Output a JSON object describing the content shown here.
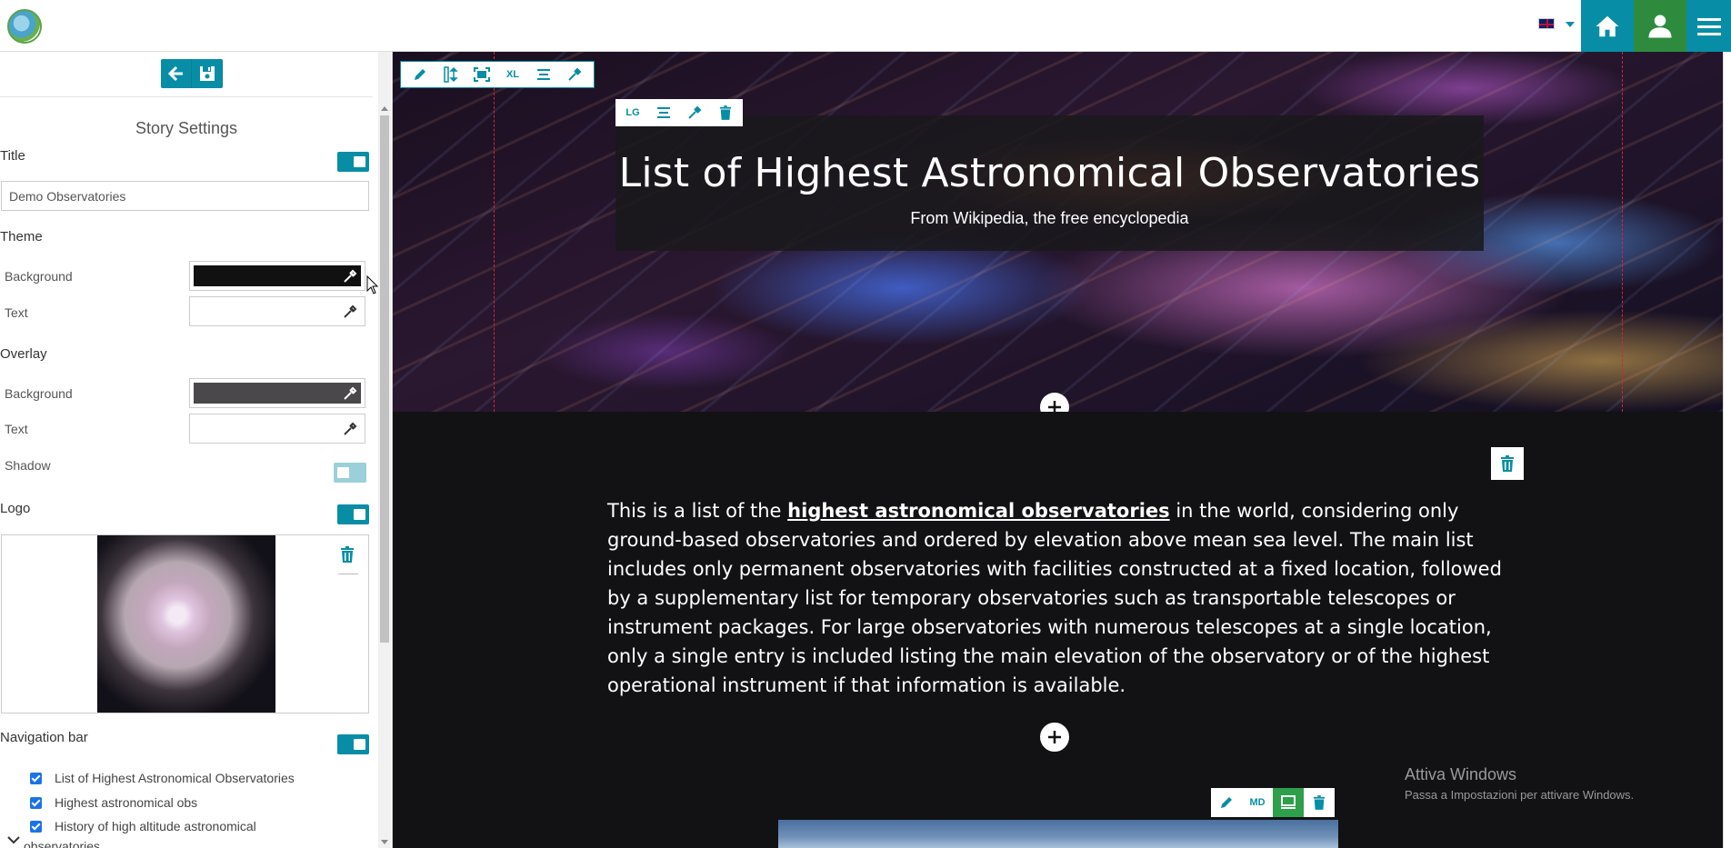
{
  "header": {
    "language": "English",
    "icons": [
      "globe-logo",
      "uk-flag",
      "home-icon",
      "user-icon",
      "hamburger-menu-icon"
    ]
  },
  "sidebar": {
    "heading": "Story Settings",
    "title_label": "Title",
    "title_value": "Demo Observatories",
    "theme": {
      "label": "Theme",
      "background_label": "Background",
      "background_color": "#111111",
      "text_label": "Text",
      "text_color": "#ffffff"
    },
    "overlay": {
      "label": "Overlay",
      "background_label": "Background",
      "background_color": "#4a484a",
      "text_label": "Text",
      "text_color": "#ffffff",
      "shadow_label": "Shadow",
      "shadow_enabled": false
    },
    "logo_label": "Logo",
    "nav_label": "Navigation bar",
    "nav_items": [
      {
        "label": "List of Highest Astronomical Observatories",
        "checked": true
      },
      {
        "label": "Highest astronomical obs",
        "checked": true
      },
      {
        "label": "History of high altitude astronomical",
        "checked": true
      }
    ],
    "nav_item_overflow": "observatories"
  },
  "canvas": {
    "hero_title": "List of Highest Astronomical Observatories",
    "hero_subtitle": "From Wikipedia, the free encyclopedia",
    "hero_toolbar": [
      "pencil-icon",
      "resize-height-icon",
      "fit-screen-icon",
      "XL",
      "align-icon",
      "eyedropper-icon"
    ],
    "title_toolbar": [
      "LG",
      "align-icon",
      "eyedropper-icon",
      "trash-icon"
    ],
    "paragraph": {
      "before": "This is a list of the ",
      "link": "highest astronomical observatories",
      "after": " in the world, considering only ground-based observatories and ordered by elevation above mean sea level. The main list includes only permanent observatories with facilities constructed at a fixed location, followed by a supplementary list for temporary observatories such as transportable telescopes or instrument packages. For large observatories with numerous telescopes at a single location, only a single entry is included listing the main elevation of the observatory or of the highest operational instrument if that information is available."
    },
    "image_toolbar": [
      "pencil-icon",
      "MD",
      "monitor-icon",
      "trash-icon"
    ]
  },
  "watermark": {
    "line1": "Attiva Windows",
    "line2": "Passa a Impostazioni per attivare Windows."
  },
  "colors": {
    "accent": "#078ea6",
    "user_green": "#2e8b3e",
    "canvas_bg": "#121214"
  }
}
